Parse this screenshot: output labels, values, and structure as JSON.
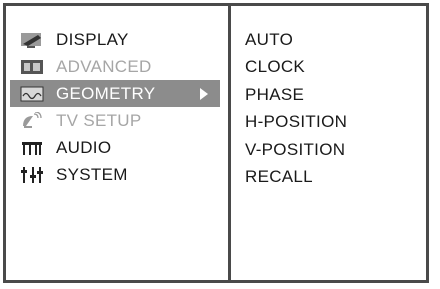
{
  "menu": {
    "items": [
      {
        "label": "DISPLAY",
        "icon": "display-icon",
        "state": "normal"
      },
      {
        "label": "ADVANCED",
        "icon": "advanced-icon",
        "state": "disabled"
      },
      {
        "label": "GEOMETRY",
        "icon": "geometry-icon",
        "state": "selected"
      },
      {
        "label": "TV SETUP",
        "icon": "satellite-icon",
        "state": "disabled"
      },
      {
        "label": "AUDIO",
        "icon": "audio-icon",
        "state": "normal"
      },
      {
        "label": "SYSTEM",
        "icon": "system-icon",
        "state": "normal"
      }
    ]
  },
  "submenu": {
    "items": [
      "AUTO",
      "CLOCK",
      "PHASE",
      "H-POSITION",
      "V-POSITION",
      "RECALL"
    ]
  },
  "colors": {
    "border": "#4a4a4a",
    "selected_bg": "#8c8c8c",
    "disabled_text": "#a6a6a6"
  }
}
